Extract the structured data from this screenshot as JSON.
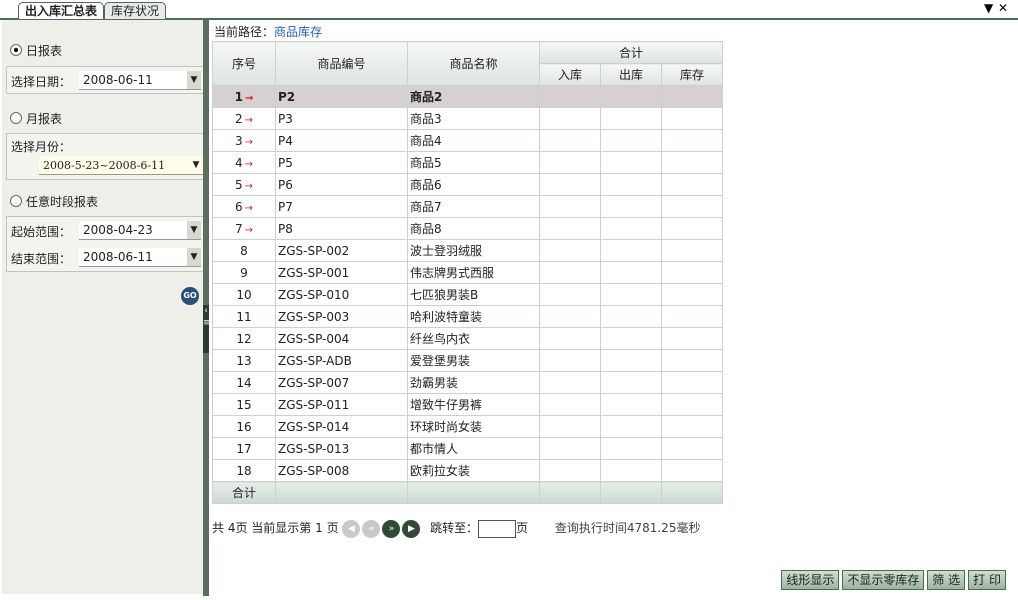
{
  "tabs": [
    {
      "label": "出入库汇总表",
      "active": true
    },
    {
      "label": "库存状况",
      "active": false
    }
  ],
  "window_controls": {
    "dropdown": "▼",
    "close": "✕"
  },
  "left": {
    "daily": {
      "label": "日报表",
      "date_label": "选择日期：",
      "date_value": "2008-06-11"
    },
    "monthly": {
      "label": "月报表",
      "month_label": "选择月份：",
      "month_value": "2008-5-23~2008-6-11"
    },
    "custom": {
      "label": "任意时段报表",
      "start_label": "起始范围：",
      "start_value": "2008-04-23",
      "end_label": "结束范围：",
      "end_value": "2008-06-11"
    },
    "go_label": "GO"
  },
  "breadcrumb": {
    "prefix": "当前路径：",
    "link": "商品库存"
  },
  "table": {
    "headers": {
      "index": "序号",
      "code": "商品编号",
      "name": "商品名称",
      "total": "合计",
      "in": "入库",
      "out": "出库",
      "stock": "库存"
    },
    "rows": [
      {
        "index": "1",
        "code": "P2",
        "name": "商品2",
        "arrow": true
      },
      {
        "index": "2",
        "code": "P3",
        "name": "商品3",
        "arrow": true
      },
      {
        "index": "3",
        "code": "P4",
        "name": "商品4",
        "arrow": true
      },
      {
        "index": "4",
        "code": "P5",
        "name": "商品5",
        "arrow": true
      },
      {
        "index": "5",
        "code": "P6",
        "name": "商品6",
        "arrow": true
      },
      {
        "index": "6",
        "code": "P7",
        "name": "商品7",
        "arrow": true
      },
      {
        "index": "7",
        "code": "P8",
        "name": "商品8",
        "arrow": true
      },
      {
        "index": "8",
        "code": "ZGS-SP-002",
        "name": "波士登羽绒服"
      },
      {
        "index": "9",
        "code": "ZGS-SP-001",
        "name": "伟志牌男式西服"
      },
      {
        "index": "10",
        "code": "ZGS-SP-010",
        "name": "七匹狼男装B"
      },
      {
        "index": "11",
        "code": "ZGS-SP-003",
        "name": "哈利波特童装"
      },
      {
        "index": "12",
        "code": "ZGS-SP-004",
        "name": "纤丝鸟内衣"
      },
      {
        "index": "13",
        "code": "ZGS-SP-ADB",
        "name": "爱登堡男装"
      },
      {
        "index": "14",
        "code": "ZGS-SP-007",
        "name": "劲霸男装"
      },
      {
        "index": "15",
        "code": "ZGS-SP-011",
        "name": "增致牛仔男裤"
      },
      {
        "index": "16",
        "code": "ZGS-SP-014",
        "name": "环球时尚女装"
      },
      {
        "index": "17",
        "code": "ZGS-SP-013",
        "name": "都市情人"
      },
      {
        "index": "18",
        "code": "ZGS-SP-008",
        "name": "欧莉拉女装"
      }
    ],
    "sum_label": "合计"
  },
  "pager": {
    "total_prefix": "共",
    "total_pages": "4",
    "total_suffix": "页 当前显示第",
    "current": "1",
    "current_suffix": "页",
    "jump_label": "跳转至：",
    "jump_suffix": "页",
    "query_time": "查询执行时间4781.25毫秒"
  },
  "actions": [
    "线形显示",
    "不显示零库存",
    "筛 选",
    "打 印"
  ]
}
